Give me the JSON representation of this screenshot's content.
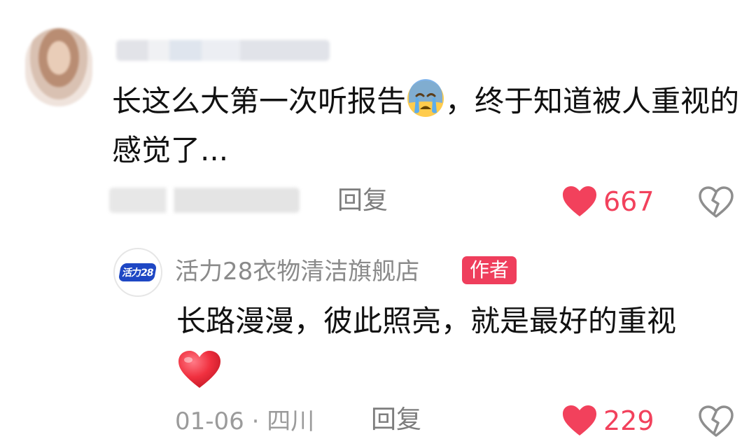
{
  "comment": {
    "text_before_emoji": "长这么大第一次听报告",
    "emoji": "crying-face-emoji",
    "text_after_emoji": "，终于知道被人重视的感觉了...",
    "reply_label": "回复",
    "like_count": "667"
  },
  "reply": {
    "username": "活力28衣物清洁旗舰店",
    "logo_text": "活力28",
    "author_badge": "作者",
    "text": "长路漫漫，彼此照亮，就是最好的重视",
    "emoji": "red-heart-emoji",
    "date": "01-06",
    "location": "四川",
    "separator": "·",
    "reply_label": "回复",
    "like_count": "229"
  },
  "colors": {
    "like_red": "#f2415c",
    "badge_red": "#ef3e5c",
    "meta_gray": "#9b9b9b"
  }
}
